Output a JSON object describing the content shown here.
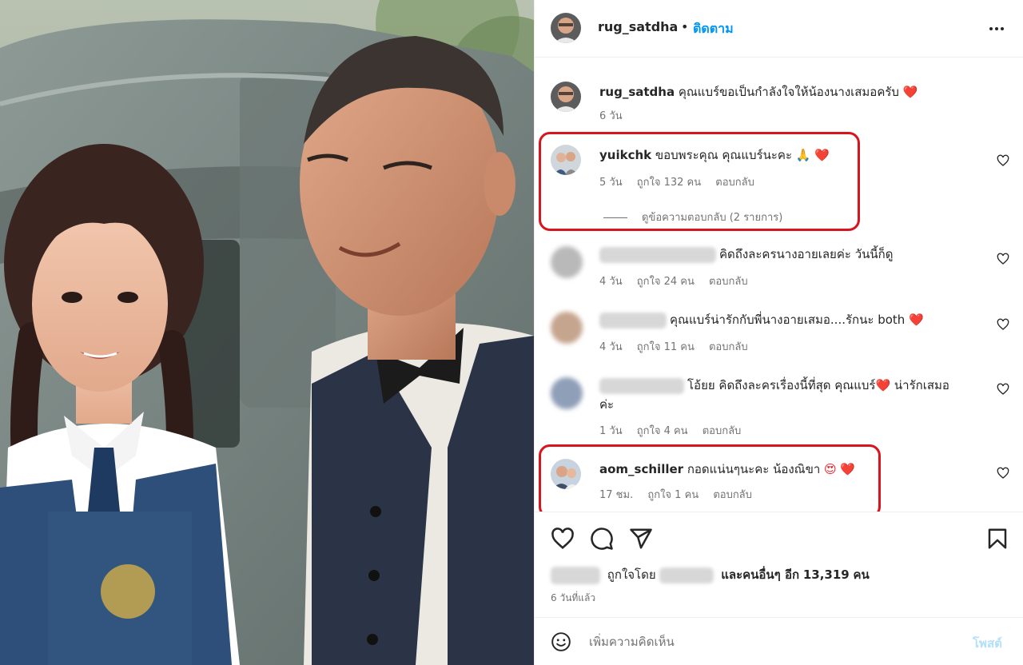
{
  "post": {
    "author": "rug_satdha",
    "separator": "•",
    "follow_label": "ติดตาม",
    "more_icon": "more-horizontal-icon"
  },
  "caption": {
    "user": "rug_satdha",
    "text": " คุณแบร์ขอเป็นกำลังใจให้น้องนางเสมอครับ",
    "emoji": "❤️",
    "time": "6 วัน"
  },
  "comments": [
    {
      "user": "yuikchk",
      "text": " ขอบพระคุณ คุณแบร์นะคะ ",
      "emoji": "🙏 ❤️",
      "time": "5 วัน",
      "likes": "ถูกใจ 132 คน",
      "reply": "ตอบกลับ",
      "view_replies": "ดูข้อความตอบกลับ (2 รายการ)",
      "highlighted": true
    },
    {
      "user": "",
      "text": "คิดถึงละครนางอายเลยค่ะ วันนี้ก็ดู",
      "emoji": "",
      "time": "4 วัน",
      "likes": "ถูกใจ 24 คน",
      "reply": "ตอบกลับ",
      "blurred_user": true
    },
    {
      "user": "",
      "text": "คุณแบร์น่ารักกับพี่นางอายเสมอ....รักนะ both ",
      "emoji": "❤️",
      "time": "4 วัน",
      "likes": "ถูกใจ 11 คน",
      "reply": "ตอบกลับ",
      "blurred_user": true
    },
    {
      "user": "",
      "text_part1": "โอ้ยย คิดถึงละครเรื่องนี้ที่สุด คุณแบร์",
      "emoji": "❤️",
      "text_part2": " น่ารักเสมอค่ะ",
      "time": "1 วัน",
      "likes": "ถูกใจ 4 คน",
      "reply": "ตอบกลับ",
      "blurred_user": true
    },
    {
      "user": "aom_schiller",
      "text": " กอดแน่นๆนะคะ น้องณิขา ",
      "emoji": "😍 ❤️",
      "time": "17 ชม.",
      "likes": "ถูกใจ 1 คน",
      "reply": "ตอบกลับ",
      "highlighted": true
    }
  ],
  "footer": {
    "liked_by_prefix": "ถูกใจโดย",
    "liked_by_suffix": "และคนอื่นๆ อีก",
    "like_count": "13,319",
    "like_unit": "คน",
    "time_ago": "6 วันที่แล้ว",
    "icons": [
      "heart-icon",
      "comment-icon",
      "share-icon",
      "bookmark-icon"
    ]
  },
  "add_comment": {
    "placeholder": "เพิ่มความคิดเห็น",
    "post_label": "โพสต์"
  },
  "colors": {
    "accent": "#0095f6",
    "highlight_border": "#d8141f",
    "muted": "#737373"
  }
}
